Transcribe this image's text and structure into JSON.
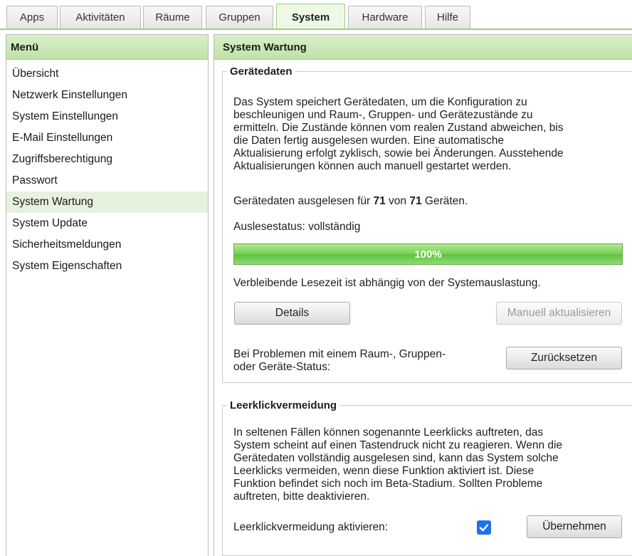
{
  "tabs": [
    {
      "label": "Apps",
      "active": false
    },
    {
      "label": "Aktivitäten",
      "active": false
    },
    {
      "label": "Räume",
      "active": false
    },
    {
      "label": "Gruppen",
      "active": false
    },
    {
      "label": "System",
      "active": true
    },
    {
      "label": "Hardware",
      "active": false
    },
    {
      "label": "Hilfe",
      "active": false
    }
  ],
  "sidebar": {
    "title": "Menü",
    "items": [
      {
        "label": "Übersicht"
      },
      {
        "label": "Netzwerk Einstellungen"
      },
      {
        "label": "System Einstellungen"
      },
      {
        "label": "E-Mail Einstellungen"
      },
      {
        "label": "Zugriffsberechtigung"
      },
      {
        "label": "Passwort"
      },
      {
        "label": "System Wartung",
        "active": true
      },
      {
        "label": "System Update"
      },
      {
        "label": "Sicherheitsmeldungen"
      },
      {
        "label": "System Eigenschaften"
      }
    ]
  },
  "main": {
    "title": "System Wartung",
    "device_data": {
      "legend": "Gerätedaten",
      "description_lines": [
        "Das System speichert Gerätedaten, um die Konfiguration zu",
        "beschleunigen und Raum-, Gruppen- und Gerätezustände zu",
        "ermitteln. Die Zustände können vom realen Zustand abweichen, bis",
        "die Daten fertig ausgelesen wurden. Eine automatische",
        "Aktualisierung erfolgt zyklisch, sowie bei Änderungen. Ausstehende",
        "Aktualisierungen können auch manuell gestartet werden."
      ],
      "read_prefix": "Gerätedaten ausgelesen für",
      "read_count": "71",
      "read_middle": "von",
      "read_total": "71",
      "read_suffix": "Geräten.",
      "status_text": "Auslesestatus: vollständig",
      "progress_percent": 100,
      "progress_label": "100%",
      "remaining_text": "Verbleibende Lesezeit ist abhängig von der Systemauslastung.",
      "details_button": "Details",
      "manual_update_button": "Manuell aktualisieren",
      "problem_lines": [
        "Bei Problemen mit einem Raum-, Gruppen-",
        "oder Geräte-Status:"
      ],
      "reset_button": "Zurücksetzen"
    },
    "empty_click": {
      "legend": "Leerklickvermeidung",
      "description_lines": [
        "In seltenen Fällen können sogenannte Leerklicks auftreten, das",
        "System scheint auf einen Tastendruck nicht zu reagieren. Wenn die",
        "Gerätedaten vollständig ausgelesen sind, kann das System solche",
        "Leerklicks vermeiden, wenn diese Funktion aktiviert ist. Diese",
        "Funktion befindet sich noch im Beta-Stadium. Sollten Probleme",
        "auftreten, bitte deaktivieren."
      ],
      "activate_label": "Leerklickvermeidung aktivieren:",
      "activate_checked": true,
      "apply_button": "Übernehmen"
    }
  },
  "colors": {
    "accent_green": "#74cf52",
    "header_green": "#bfe2a6",
    "checkbox_blue": "#1a73e8"
  }
}
